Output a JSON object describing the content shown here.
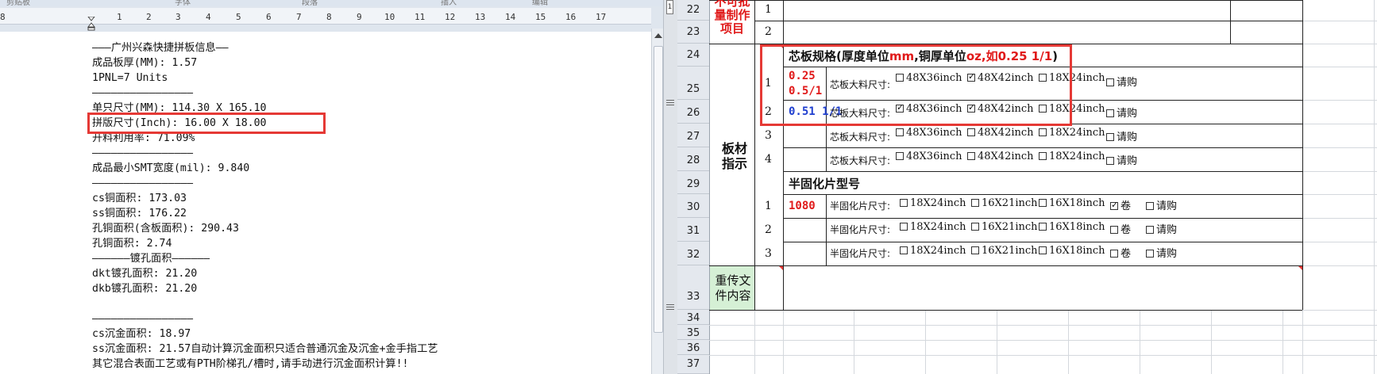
{
  "ribbon": {
    "groups": [
      "剪贴板",
      "字体",
      "段落",
      "插入",
      "编辑"
    ]
  },
  "ruler": {
    "numbers": [
      "8",
      "1",
      "2",
      "3",
      "4",
      "5",
      "6",
      "7",
      "8",
      "9",
      "10",
      "11",
      "12",
      "13",
      "14",
      "15",
      "16",
      "17"
    ]
  },
  "document": {
    "lines": [
      "———广州兴森快捷拼板信息——",
      "成品板厚(MM): 1.57",
      "1PNL=7 Units",
      "————————————————",
      "单只尺寸(MM): 114.30 X 165.10",
      "拼版尺寸(Inch): 16.00 X 18.00",
      "开料利用率: 71.09%",
      "————————————————",
      "成品最小SMT宽度(mil): 9.840",
      "————————————————",
      "cs铜面积: 173.03",
      "ss铜面积: 176.22",
      "孔铜面积(含板面积): 290.43",
      "孔铜面积: 2.74",
      "——————镀孔面积——————",
      "dkt镀孔面积: 21.20",
      "dkb镀孔面积: 21.20",
      "",
      "————————————————",
      "cs沉金面积: 18.97",
      "ss沉金面积: 21.57自动计算沉金面积只适合普通沉金及沉金+金手指工艺",
      "其它混合表面工艺或有PTH阶梯孔/槽时,请手动进行沉金面积计算!!"
    ]
  },
  "splitter": {
    "label": "1"
  },
  "sheet": {
    "row_numbers": [
      "22",
      "23",
      "24",
      "25",
      "26",
      "27",
      "28",
      "29",
      "30",
      "31",
      "32",
      "33",
      "34",
      "35",
      "36",
      "37"
    ],
    "unbatchable_label": "不可批量制作项目",
    "unbatchable_rows": [
      "1",
      "2"
    ],
    "board_indicator_label": "板材指示",
    "core_spec": {
      "header_prefix": "芯板规格(厚度单位",
      "unit_mm": "mm",
      "header_mid": ",铜厚单位",
      "unit_oz": "oz",
      "header_example": ",如0.25 1/1",
      "header_suffix": ")",
      "size_label": "芯板大料尺寸:",
      "options": [
        "48X36inch",
        "48X42inch",
        "18X24inch",
        "请购"
      ],
      "rows": [
        {
          "index": "1",
          "value_line1": "0.25",
          "value_line2": "0.5/1",
          "checked": [
            false,
            true,
            false,
            false
          ]
        },
        {
          "index": "2",
          "value_line1": "0.51 1/1",
          "value_line2": "",
          "checked": [
            true,
            true,
            false,
            false
          ]
        },
        {
          "index": "3",
          "value_line1": "",
          "value_line2": "",
          "checked": [
            false,
            false,
            false,
            false
          ]
        },
        {
          "index": "4",
          "value_line1": "",
          "value_line2": "",
          "checked": [
            false,
            false,
            false,
            false
          ]
        }
      ]
    },
    "prepreg": {
      "header": "半固化片型号",
      "size_label": "半固化片尺寸:",
      "options": [
        "18X24inch",
        "16X21inch",
        "16X18inch",
        "卷",
        "请购"
      ],
      "rows": [
        {
          "index": "1",
          "value": "1080",
          "checked": [
            false,
            false,
            false,
            true,
            false
          ]
        },
        {
          "index": "2",
          "value": "",
          "checked": [
            false,
            false,
            false,
            false,
            false
          ]
        },
        {
          "index": "3",
          "value": "",
          "checked": [
            false,
            false,
            false,
            false,
            false
          ]
        }
      ]
    },
    "reupload_label": "重传文件内容"
  }
}
